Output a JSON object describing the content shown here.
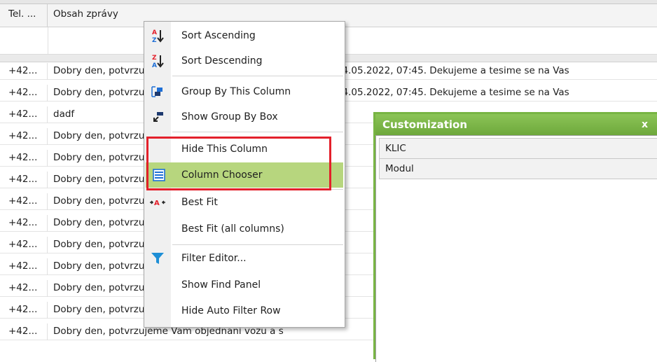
{
  "grid": {
    "columns": [
      "Tel. ...",
      "Obsah zprávy"
    ],
    "rows": [
      {
        "tel": "+42...",
        "msg": "Dobry den, potvrzujeme Vam objednani vozu na servis dne 04.05.2022, 07:45. Dekujeme a tesime se na Vas"
      },
      {
        "tel": "+42...",
        "msg": "Dobry den, potvrzujeme Vam objednani vozu na servis dne 04.05.2022, 07:45. Dekujeme a tesime se na Vas"
      },
      {
        "tel": "+42...",
        "msg": "dadf"
      },
      {
        "tel": "+42...",
        "msg": "Dobry den, potvrzujeme Vam objednani vozu na servis"
      },
      {
        "tel": "+42...",
        "msg": "Dobry den, potvrzujeme Vam objednani vozu na"
      },
      {
        "tel": "+42...",
        "msg": "Dobry den, potvrzujeme Vam objednani vozu na servis"
      },
      {
        "tel": "+42...",
        "msg": "Dobry den, potvrzujeme Vam objednani vozu na s"
      },
      {
        "tel": "+42...",
        "msg": "Dobry den, potvrzujeme Vam objednani vozu na s"
      },
      {
        "tel": "+42...",
        "msg": "Dobry den, potvrzujeme Vam objednani vozu 3 na s"
      },
      {
        "tel": "+42...",
        "msg": "Dobry den, potvrzujeme Vam objednani vozu 3 na s"
      },
      {
        "tel": "+42...",
        "msg": "Dobry den, potvrzujeme Vam objednani vozu 3 na s"
      },
      {
        "tel": "+42...",
        "msg": "Dobry den, potvrzujeme Vam objednani vozu 7C6 65-73 na s"
      },
      {
        "tel": "+42...",
        "msg": "Dobry den, potvrzujeme Vam objednani vozu        a s"
      }
    ]
  },
  "context_menu": {
    "items": [
      {
        "label": "Sort Ascending",
        "icon": "sort-ascending-icon"
      },
      {
        "label": "Sort Descending",
        "icon": "sort-descending-icon"
      },
      {
        "label": "Group By This Column",
        "icon": "group-by-column-icon"
      },
      {
        "label": "Show Group By Box",
        "icon": "group-by-box-icon"
      },
      {
        "label": "Hide This Column",
        "icon": ""
      },
      {
        "label": "Column Chooser",
        "icon": "column-chooser-icon",
        "highlighted": true
      },
      {
        "label": "Best Fit",
        "icon": "best-fit-icon"
      },
      {
        "label": "Best Fit (all columns)",
        "icon": ""
      },
      {
        "label": "Filter Editor...",
        "icon": "filter-icon"
      },
      {
        "label": "Show Find Panel",
        "icon": ""
      },
      {
        "label": "Hide Auto Filter Row",
        "icon": ""
      }
    ]
  },
  "customization": {
    "title": "Customization",
    "close": "x",
    "items": [
      "KLIC",
      "Modul"
    ]
  },
  "colors": {
    "highlight": "#b7d67e",
    "customization_title": "#78b543",
    "callout": "#e3202b",
    "filter_icon": "#1e8fd6"
  }
}
